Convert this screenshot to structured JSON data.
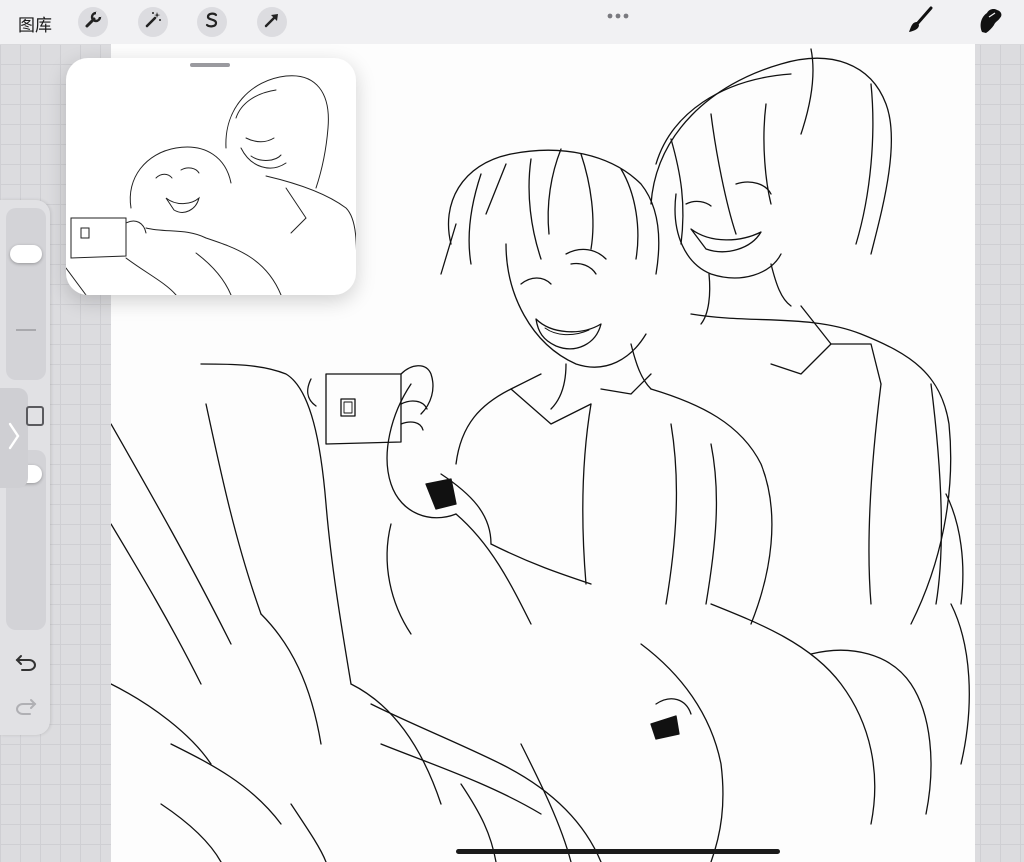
{
  "topbar": {
    "gallery_label": "图库",
    "left_tools": [
      {
        "name": "actions",
        "icon": "wrench-icon"
      },
      {
        "name": "adjustments",
        "icon": "magic-wand-icon"
      },
      {
        "name": "selection",
        "icon": "selection-s-icon"
      },
      {
        "name": "transform",
        "icon": "arrow-cursor-icon"
      }
    ],
    "more_icon": "more-dots-icon",
    "right_tools": [
      {
        "name": "brush",
        "icon": "brush-icon"
      },
      {
        "name": "smudge",
        "icon": "smudge-finger-icon"
      }
    ]
  },
  "reference_window": {
    "title": "reference",
    "icon": "drag-handle-icon"
  },
  "sidebar": {
    "brush_size_level": 0.22,
    "opacity_level": 0.06,
    "modify_icon": "modify-square-icon",
    "collapse_icon": "chevron-right-icon",
    "undo_icon": "undo-icon",
    "redo_icon": "redo-icon"
  },
  "colors": {
    "ui_background": "#e6e6e9",
    "canvas": "#fdfdfd",
    "ink": "#111111"
  }
}
